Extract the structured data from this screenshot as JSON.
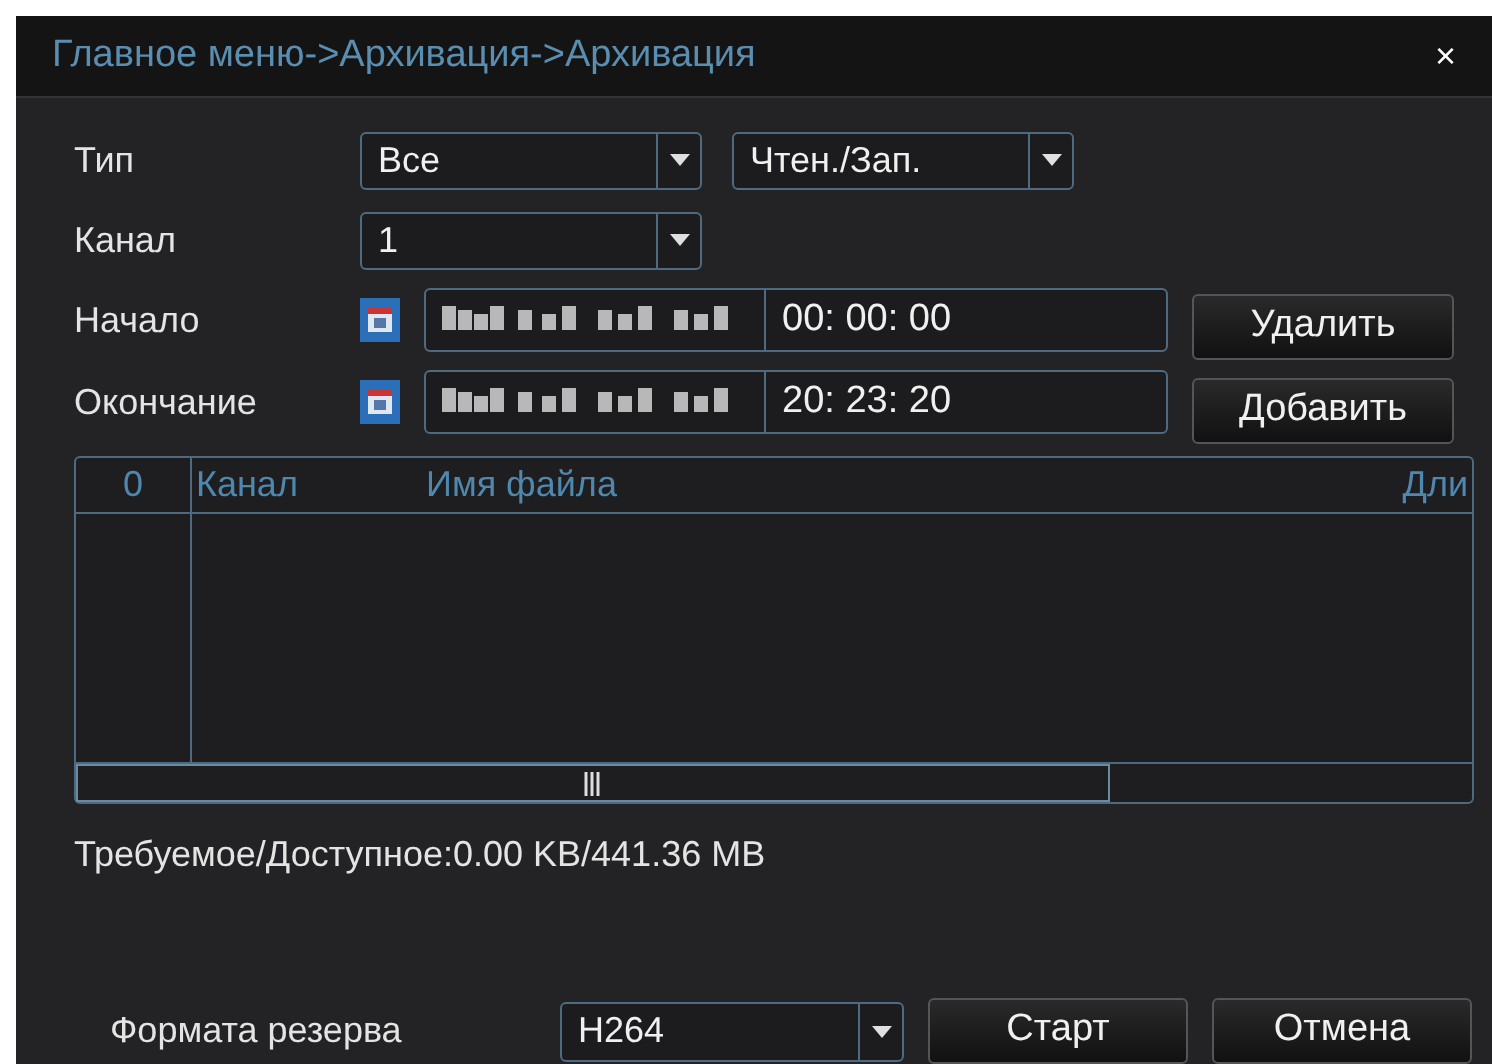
{
  "window": {
    "title": "Главное меню->Архивация->Архивация",
    "close": "×"
  },
  "type_row": {
    "label": "Тип",
    "value": "Все",
    "mode": "Чтен./Зап."
  },
  "channel_row": {
    "label": "Канал",
    "value": "1"
  },
  "start_row": {
    "label": "Начало",
    "time": "00: 00: 00",
    "button": "Удалить"
  },
  "end_row": {
    "label": "Окончание",
    "time": "20: 23: 20",
    "button": "Добавить"
  },
  "table": {
    "columns": [
      "0",
      "Канал",
      "Имя файла",
      "Дли"
    ]
  },
  "space_info": "Требуемое/Доступное:0.00 KB/441.36 MB",
  "footer": {
    "format_label": "Формата резерва",
    "format_value": "H264",
    "buttons": [
      "Старт",
      "Отмена"
    ]
  }
}
